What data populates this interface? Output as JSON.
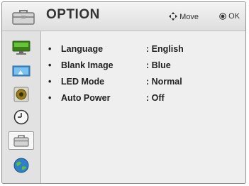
{
  "header": {
    "title": "OPTION",
    "move_hint": "Move",
    "ok_hint": "OK",
    "icon": "toolbox-icon"
  },
  "sidebar": {
    "tabs": [
      {
        "name": "picture",
        "icon": "monitor-icon",
        "selected": false
      },
      {
        "name": "screen",
        "icon": "screen-icon",
        "selected": false
      },
      {
        "name": "audio",
        "icon": "speaker-icon",
        "selected": false
      },
      {
        "name": "time",
        "icon": "clock-icon",
        "selected": false
      },
      {
        "name": "option",
        "icon": "toolbox-icon",
        "selected": true
      },
      {
        "name": "network",
        "icon": "globe-icon",
        "selected": false
      }
    ]
  },
  "menu": {
    "bullet": "•",
    "items": [
      {
        "label": "Language",
        "value": ": English"
      },
      {
        "label": "Blank Image",
        "value": ": Blue"
      },
      {
        "label": "LED Mode",
        "value": ": Normal"
      },
      {
        "label": "Auto Power",
        "value": ": Off"
      }
    ]
  },
  "colors": {
    "panel": "#efefef",
    "sidebar": "#e2e2e2",
    "text": "#222222"
  }
}
